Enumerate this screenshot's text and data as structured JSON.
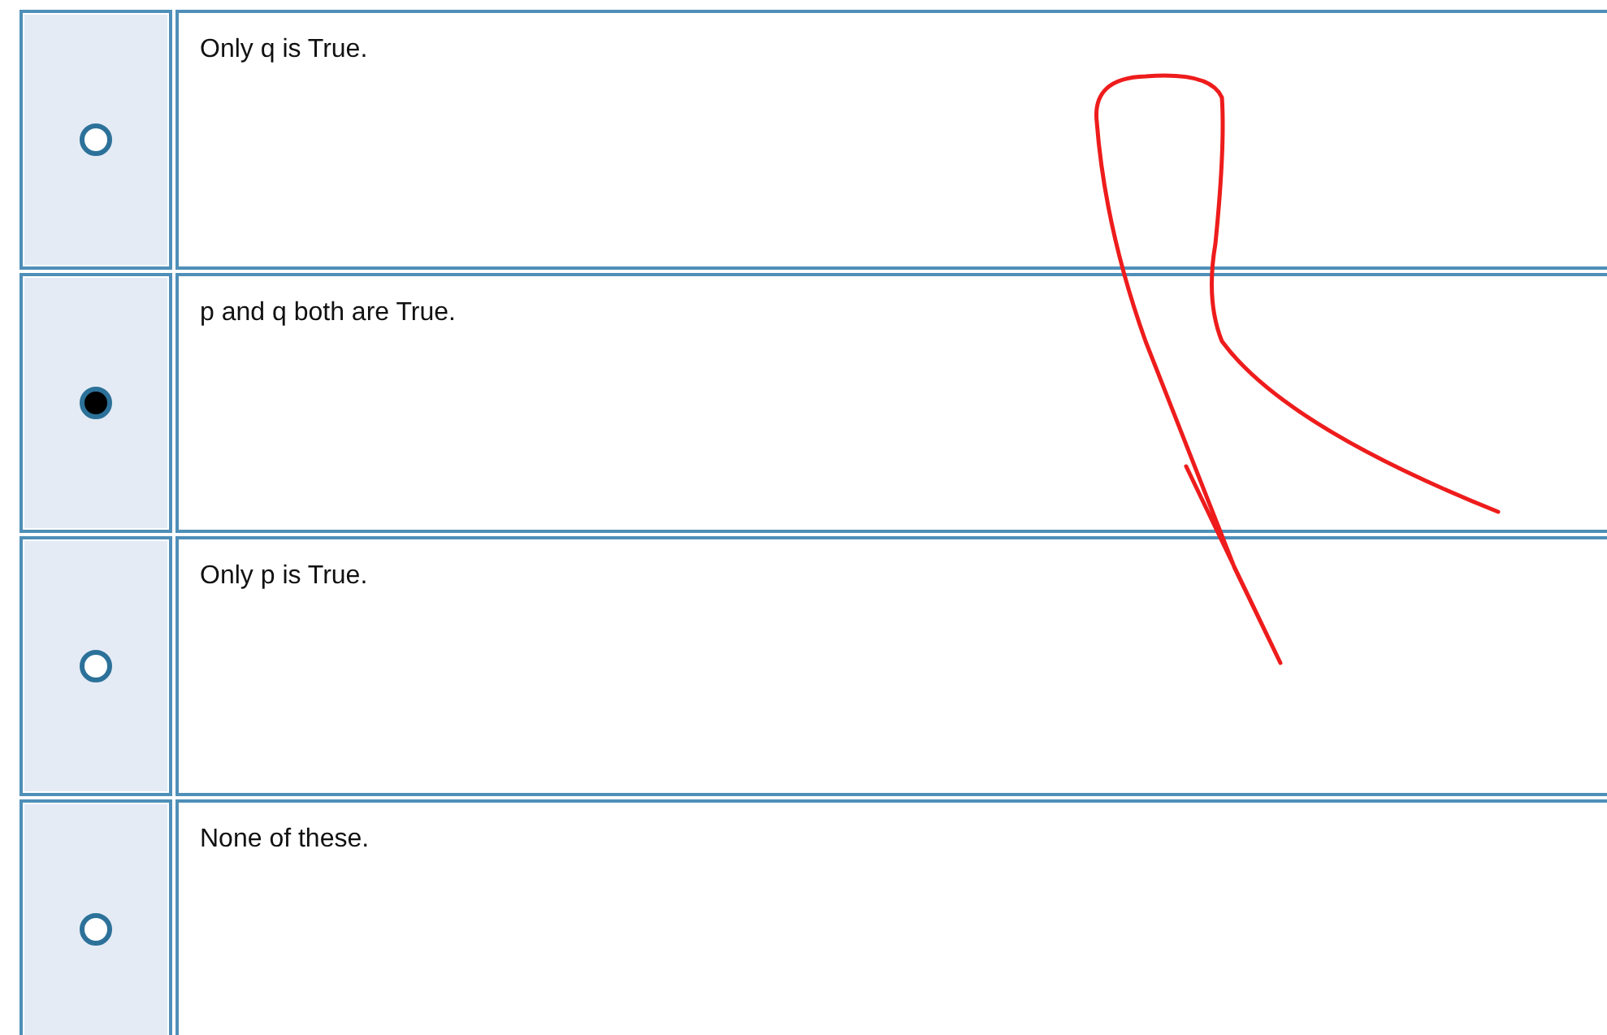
{
  "options": [
    {
      "text": "Only q is True.",
      "selected": false
    },
    {
      "text": "p and q both are True.",
      "selected": true
    },
    {
      "text": "Only p is True.",
      "selected": false
    },
    {
      "text": "None of these.",
      "selected": false
    }
  ]
}
